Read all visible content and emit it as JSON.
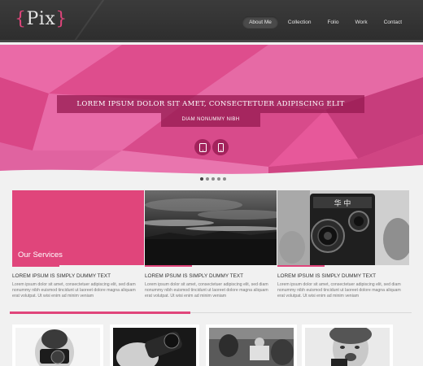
{
  "header": {
    "logo_text": "Pix",
    "logo_open_brace": "{",
    "logo_close_brace": "}",
    "nav": [
      {
        "label": "About Me",
        "active": true
      },
      {
        "label": "Collection",
        "active": false
      },
      {
        "label": "Folio",
        "active": false
      },
      {
        "label": "Work",
        "active": false
      },
      {
        "label": "Contact",
        "active": false
      }
    ]
  },
  "hero": {
    "title": "LOREM IPSUM DOLOR SIT AMET, CONSECTETUER ADIPISCING ELIT",
    "subtitle": "DIAM NONUMMY NIBH",
    "buttons": [
      "tablet-icon",
      "phone-icon"
    ],
    "slides": 5,
    "active_slide": 1
  },
  "services": {
    "label": "Our Services",
    "cards": [
      {
        "title": "LOREM IPSUM IS SIMPLY DUMMY TEXT",
        "text": "Lorem ipsum dolor sit amet, consectetuer adipiscing elit, sed diam nonummy nibh euismod tincidunt ut laoreet dolore magna aliquam erat volutpat. Ut wisi enim ad minim veniam"
      },
      {
        "title": "LOREM IPSUM IS SIMPLY DUMMY TEXT",
        "text": "Lorem ipsum dolor sit amet, consectetuer adipiscing elit, sed diam nonummy nibh euismod tincidunt ut laoreet dolore magna aliquam erat volutpat. Ut wisi enim ad minim veniam"
      },
      {
        "title": "LOREM IPSUM IS SIMPLY DUMMY TEXT",
        "text": "Lorem ipsum dolor sit amet, consectetuer adipiscing elit, sed diam nonummy nibh euismod tincidunt ut laoreet dolore magna aliquam erat volutpat. Ut wisi enim ad minim veniam"
      }
    ],
    "camera_label": "华 中"
  },
  "colors": {
    "accent": "#e0457b",
    "header_bg": "#333333",
    "hero_pink": "#e8559a"
  }
}
